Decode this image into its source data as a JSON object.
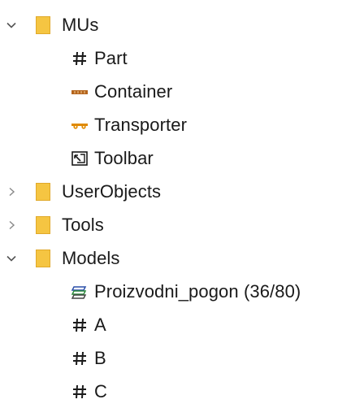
{
  "tree": {
    "mus": {
      "label": "MUs",
      "expanded": true,
      "children": {
        "part": {
          "label": "Part",
          "icon": "hash-icon"
        },
        "container": {
          "label": "Container",
          "icon": "container-icon"
        },
        "transporter": {
          "label": "Transporter",
          "icon": "transporter-icon"
        },
        "toolbar": {
          "label": "Toolbar",
          "icon": "toolbar-icon"
        }
      }
    },
    "userobjects": {
      "label": "UserObjects",
      "expanded": false
    },
    "tools": {
      "label": "Tools",
      "expanded": false
    },
    "models": {
      "label": "Models",
      "expanded": true,
      "children": {
        "proizvodni": {
          "label": "Proizvodni_pogon (36/80)",
          "icon": "frame-icon"
        },
        "a": {
          "label": "A",
          "icon": "hash-icon"
        },
        "b": {
          "label": "B",
          "icon": "hash-icon"
        },
        "c": {
          "label": "C",
          "icon": "hash-icon"
        }
      }
    }
  },
  "colors": {
    "folder": "#f5c542",
    "folder_edge": "#e0a92a",
    "chevron": "#555555",
    "container_icon": "#b5651d",
    "transporter_icon": "#e08a00",
    "text": "#1a1a1a"
  }
}
